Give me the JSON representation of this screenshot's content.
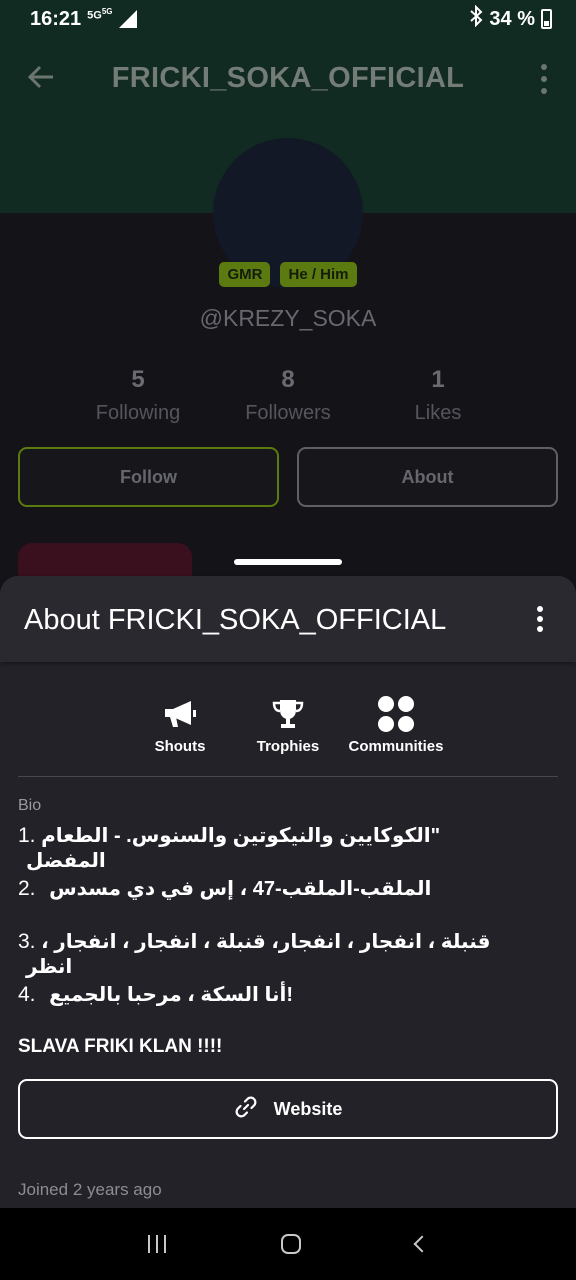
{
  "status_bar": {
    "time": "16:21",
    "network": "5G",
    "network_sup": "5G",
    "battery": "34 %"
  },
  "header": {
    "title": "FRICKI_SOKA_OFFICIAL"
  },
  "profile": {
    "tags": [
      "GMR",
      "He / Him"
    ],
    "handle": "@KREZY_SOKA",
    "stats": [
      {
        "value": "5",
        "label": "Following"
      },
      {
        "value": "8",
        "label": "Followers"
      },
      {
        "value": "1",
        "label": "Likes"
      }
    ],
    "follow_label": "Follow",
    "about_label": "About"
  },
  "sheet": {
    "title": "About FRICKI_SOKA_OFFICIAL",
    "tabs": [
      {
        "label": "Shouts",
        "icon": "megaphone-icon"
      },
      {
        "label": "Trophies",
        "icon": "trophy-icon"
      },
      {
        "label": "Communities",
        "icon": "communities-icon"
      }
    ],
    "bio_label": "Bio",
    "bio_lines": [
      {
        "num": "1.",
        "text": "\"الكوكايين والنيكوتين والسنوس. - الطعام المفضل"
      },
      {
        "num": "2.",
        "text": "الملقب-الملقب-47 ، إس في دي مسدس"
      },
      {
        "num": "3.",
        "text": "قنبلة ، انفجار ، انفجار، قنبلة ، انفجار ، انفجار ، انظر"
      },
      {
        "num": "4.",
        "text": "!أنا السكة ، مرحبا بالجميع"
      }
    ],
    "bio_footer": "SLAVA FRIKI KLAN !!!!",
    "website_label": "Website",
    "joined": "Joined 2 years ago"
  }
}
